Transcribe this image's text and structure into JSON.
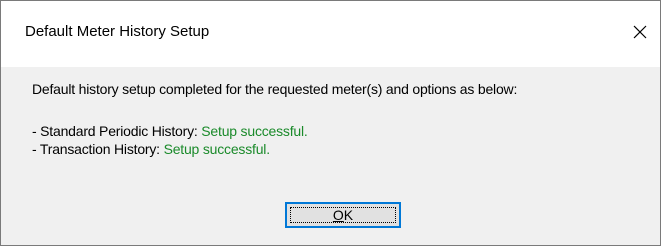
{
  "window": {
    "title": "Default Meter History Setup",
    "close_icon": "close-icon"
  },
  "message": {
    "main": "Default history setup completed for the requested meter(s) and options as below:",
    "lines": [
      {
        "label": "- Standard Periodic History: ",
        "status": "Setup successful."
      },
      {
        "label": "- Transaction History: ",
        "status": "Setup successful."
      }
    ]
  },
  "buttons": {
    "ok_mnemonic": "O",
    "ok_rest": "K"
  },
  "colors": {
    "success_text": "#1a8a2a",
    "focus_border": "#0078d7"
  }
}
